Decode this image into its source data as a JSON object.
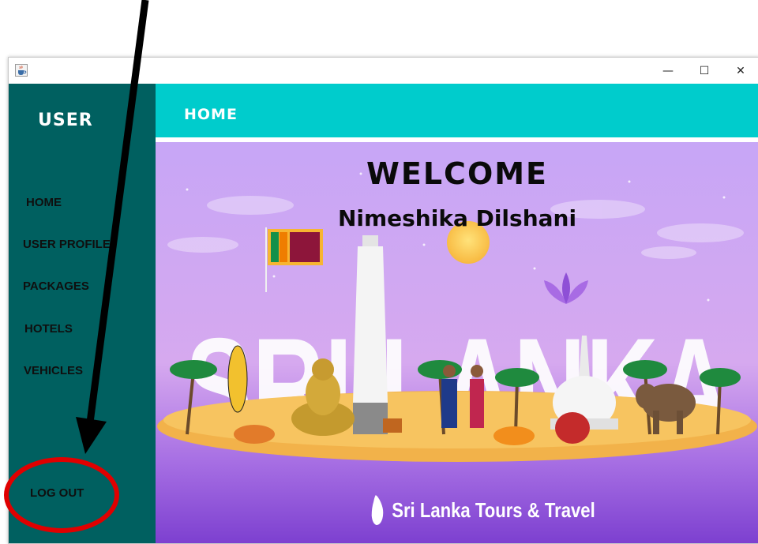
{
  "window": {
    "controls": {
      "minimize": "—",
      "maximize": "☐",
      "close": "✕"
    }
  },
  "sidebar": {
    "brand": "USER",
    "items": [
      {
        "label": "HOME"
      },
      {
        "label": "USER PROFILE"
      },
      {
        "label": "PACKAGES"
      },
      {
        "label": "HOTELS"
      },
      {
        "label": "VEHICLES"
      }
    ],
    "logout": "LOG OUT"
  },
  "header": {
    "title": "HOME"
  },
  "banner": {
    "welcome": "WELCOME",
    "user_name": "Nimeshika Dilshani",
    "country_word": "SRI LANKA",
    "brand": "Sri Lanka Tours & Travel"
  },
  "colors": {
    "sidebar_bg": "#006060",
    "header_bg": "#00cccc",
    "banner_top": "#c9a3f4",
    "banner_bottom": "#7b3fd0",
    "annotation_arrow": "#000000",
    "annotation_circle": "#e00000"
  },
  "icons": {
    "app": "java-cup-icon",
    "arrow": "annotation-arrow",
    "circle": "annotation-circle"
  }
}
